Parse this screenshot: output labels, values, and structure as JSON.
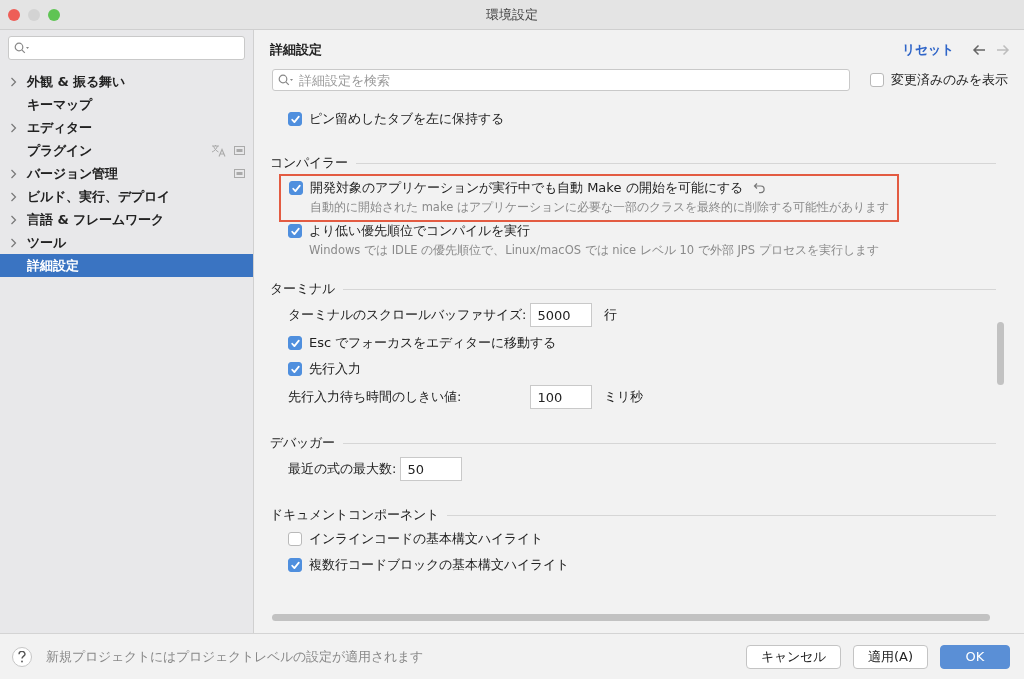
{
  "window": {
    "title": "環境設定"
  },
  "sidebar": {
    "items": [
      {
        "label": "外観 & 振る舞い",
        "expandable": true,
        "selected": false
      },
      {
        "label": "キーマップ",
        "expandable": false,
        "selected": false
      },
      {
        "label": "エディター",
        "expandable": true,
        "selected": false
      },
      {
        "label": "プラグイン",
        "expandable": false,
        "selected": false,
        "indicators": [
          {
            "kind": "translate"
          },
          {
            "kind": "module"
          }
        ]
      },
      {
        "label": "バージョン管理",
        "expandable": true,
        "selected": false,
        "indicators": [
          {
            "kind": "module"
          }
        ]
      },
      {
        "label": "ビルド、実行、デプロイ",
        "expandable": true,
        "selected": false
      },
      {
        "label": "言語 & フレームワーク",
        "expandable": true,
        "selected": false
      },
      {
        "label": "ツール",
        "expandable": true,
        "selected": false
      },
      {
        "label": "詳細設定",
        "expandable": false,
        "selected": true
      }
    ]
  },
  "panel": {
    "title": "詳細設定",
    "reset": "リセット",
    "back_enabled": true,
    "forward_enabled": false,
    "search": {
      "placeholder": "詳細設定を検索"
    },
    "modified_only": {
      "label": "変更済みのみを表示",
      "checked": false
    },
    "sections": [
      {
        "rows": [
          {
            "kind": "checkbox",
            "label": "ピン留めしたタブを左に保持する",
            "checked": true,
            "modified": false
          }
        ]
      },
      {
        "heading": "コンパイラー",
        "rows": [
          {
            "kind": "checkbox",
            "label": "開発対象のアプリケーションが実行中でも自動 Make の開始を可能にする",
            "checked": true,
            "modified": true,
            "description": "自動的に開始された make はアプリケーションに必要な一部のクラスを最終的に削除する可能性があります"
          },
          {
            "kind": "checkbox",
            "label": "より低い優先順位でコンパイルを実行",
            "checked": true,
            "modified": false,
            "description": "Windows では IDLE の優先順位で、Linux/macOS では nice レベル 10 で外部 JPS プロセスを実行します"
          }
        ]
      },
      {
        "heading": "ターミナル",
        "rows": [
          {
            "kind": "number",
            "label": "ターミナルのスクロールバッファサイズ:",
            "value": "5000",
            "unit": "行"
          },
          {
            "kind": "checkbox",
            "label": "Esc でフォーカスをエディターに移動する",
            "checked": true,
            "modified": false
          },
          {
            "kind": "checkbox",
            "label": "先行入力",
            "checked": true,
            "modified": false
          },
          {
            "kind": "number",
            "label": "先行入力待ち時間のしきい値:",
            "value": "100",
            "unit": "ミリ秒"
          }
        ]
      },
      {
        "heading": "デバッガー",
        "rows": [
          {
            "kind": "number",
            "label": "最近の式の最大数:",
            "value": "50"
          }
        ]
      },
      {
        "heading": "ドキュメントコンポーネント",
        "rows": [
          {
            "kind": "checkbox",
            "label": "インラインコードの基本構文ハイライト",
            "checked": false,
            "modified": false
          },
          {
            "kind": "checkbox",
            "label": "複数行コードブロックの基本構文ハイライト",
            "checked": true,
            "modified": false
          }
        ]
      }
    ]
  },
  "footer": {
    "hint": "新規プロジェクトにはプロジェクトレベルの設定が適用されます",
    "buttons": [
      {
        "label": "キャンセル",
        "default": false
      },
      {
        "label": "適用(A)",
        "default": false
      },
      {
        "label": "OK",
        "default": true
      }
    ]
  }
}
